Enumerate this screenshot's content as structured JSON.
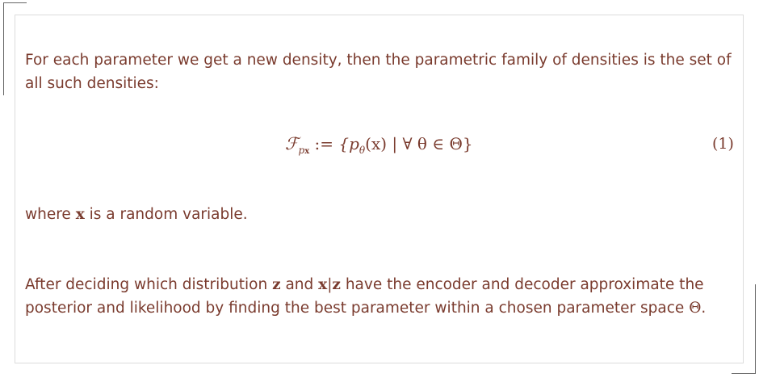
{
  "paragraph1": {
    "text": "For each parameter we get a new density, then the parametric family of densities is the set of all such densities:"
  },
  "equation": {
    "lhs_symbol": "ℱ",
    "lhs_subscript_p": "p",
    "lhs_subscript_x": "x",
    "assign": " := ",
    "set_body": "{p",
    "theta_sub": "θ",
    "paren_x": "(x)",
    "rest": " | ∀ θ ∈ Θ}",
    "number": "(1)"
  },
  "paragraph2": {
    "before": "where ",
    "var": "x",
    "after": " is a random variable."
  },
  "paragraph3": {
    "t1": "After deciding which distribution ",
    "z1": "z",
    "t2": " and ",
    "xz_x": "x",
    "xz_bar": "|",
    "xz_z": "z",
    "t3": " have the encoder and decoder approximate the posterior and likelihood by finding the best parameter within a chosen parameter space ",
    "theta": "Θ",
    "t4": "."
  }
}
